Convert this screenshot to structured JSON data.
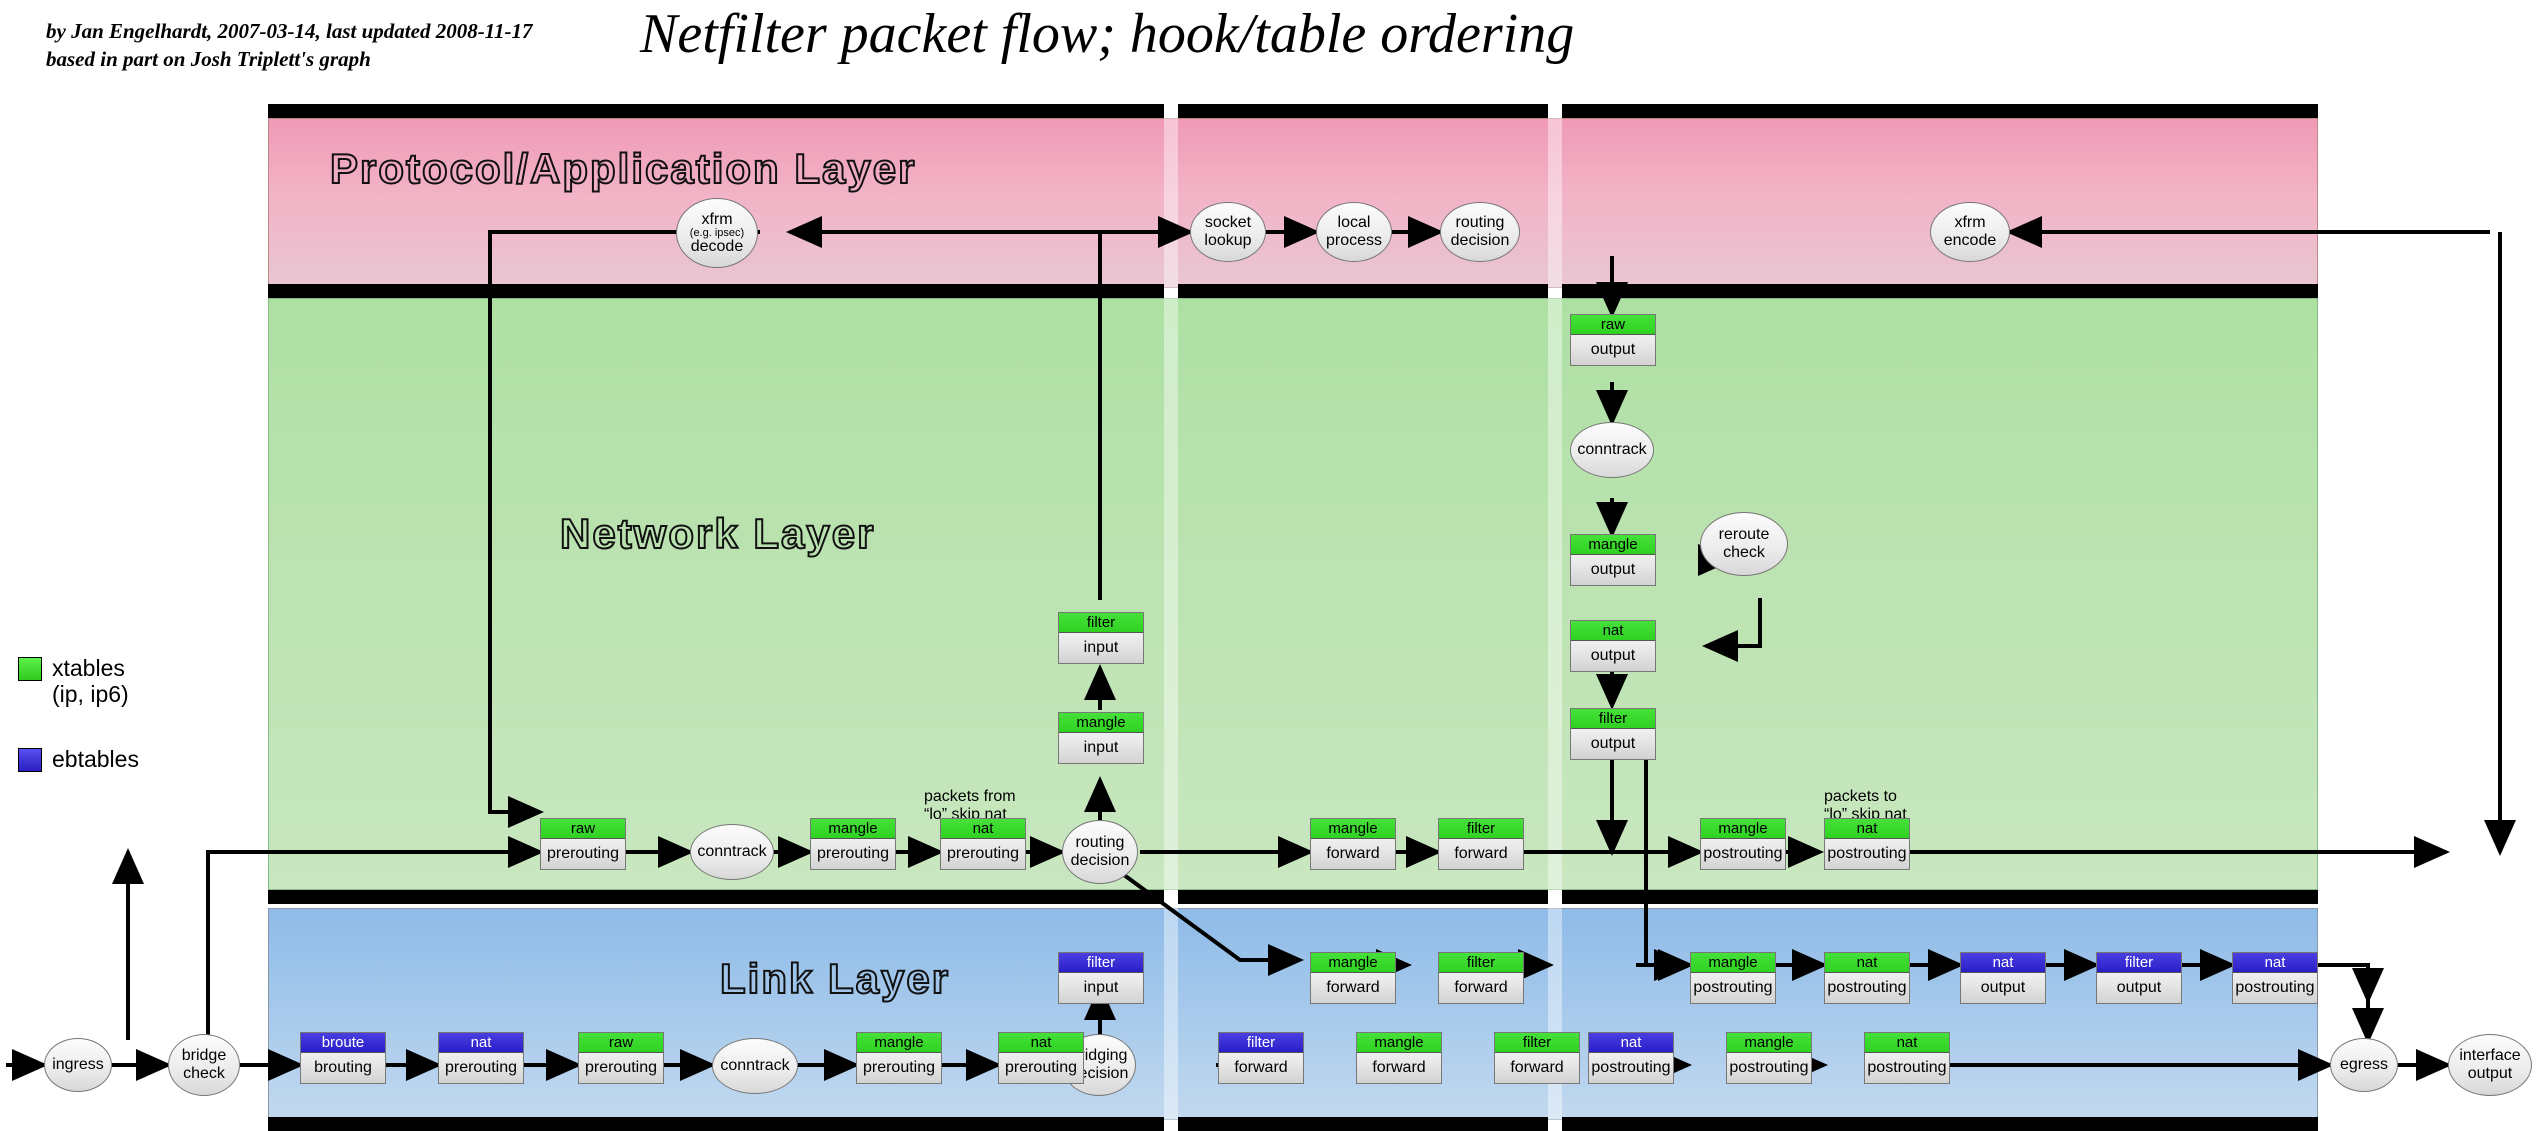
{
  "header": {
    "title": "Netfilter packet flow; hook/table ordering",
    "credit_line1": "by Jan Engelhardt, 2007-03-14, last updated 2008-11-17",
    "credit_line2": "based in part on Josh Triplett's graph"
  },
  "legend": {
    "items": [
      {
        "label": "xtables\n(ip, ip6)",
        "label_line1": "xtables",
        "label_line2": "(ip, ip6)",
        "color": "#3fd82f"
      },
      {
        "label": "ebtables",
        "label_line1": "ebtables",
        "label_line2": "",
        "color": "#3a2fd8"
      }
    ]
  },
  "layers": [
    {
      "name": "protocol",
      "title": "Protocol/Application Layer",
      "color": "#f0a0ba"
    },
    {
      "name": "network",
      "title": "Network Layer",
      "color": "#b4e2a8"
    },
    {
      "name": "link",
      "title": "Link Layer",
      "color": "#9cc4ea"
    }
  ],
  "nodes": {
    "ingress": "ingress",
    "bridge_check_l1": "bridge",
    "bridge_check_l2": "check",
    "conntrack": "conntrack",
    "bridging_decision_l1": "bridging",
    "bridging_decision_l2": "decision",
    "routing_decision_l1": "routing",
    "routing_decision_l2": "decision",
    "reroute_check_l1": "reroute",
    "reroute_check_l2": "check",
    "socket_lookup_l1": "socket",
    "socket_lookup_l2": "lookup",
    "local_process_l1": "local",
    "local_process_l2": "process",
    "xfrm_decode_l1": "xfrm",
    "xfrm_decode_sub": "(e.g. ipsec)",
    "xfrm_decode_l3": "decode",
    "xfrm_encode_l1": "xfrm",
    "xfrm_encode_l2": "encode",
    "egress": "egress",
    "interface_output_l1": "interface",
    "interface_output_l2": "output"
  },
  "notes": {
    "packets_from_lo_1": "packets from",
    "packets_from_lo_2": "“lo” skip nat",
    "packets_to_lo_1": "packets to",
    "packets_to_lo_2": "“lo” skip nat"
  },
  "chains": {
    "net_raw_pre": {
      "table": "raw",
      "chain": "prerouting",
      "family": "xtables"
    },
    "net_mangle_pre": {
      "table": "mangle",
      "chain": "prerouting",
      "family": "xtables"
    },
    "net_nat_pre": {
      "table": "nat",
      "chain": "prerouting",
      "family": "xtables"
    },
    "net_mangle_input": {
      "table": "mangle",
      "chain": "input",
      "family": "xtables"
    },
    "net_filter_input": {
      "table": "filter",
      "chain": "input",
      "family": "xtables"
    },
    "net_mangle_fwd": {
      "table": "mangle",
      "chain": "forward",
      "family": "xtables"
    },
    "net_filter_fwd": {
      "table": "filter",
      "chain": "forward",
      "family": "xtables"
    },
    "net_mangle_post": {
      "table": "mangle",
      "chain": "postrouting",
      "family": "xtables"
    },
    "net_nat_post": {
      "table": "nat",
      "chain": "postrouting",
      "family": "xtables"
    },
    "net_raw_out": {
      "table": "raw",
      "chain": "output",
      "family": "xtables"
    },
    "net_mangle_out": {
      "table": "mangle",
      "chain": "output",
      "family": "xtables"
    },
    "net_nat_out": {
      "table": "nat",
      "chain": "output",
      "family": "xtables"
    },
    "net_filter_out": {
      "table": "filter",
      "chain": "output",
      "family": "xtables"
    },
    "link_broute": {
      "table": "broute",
      "chain": "brouting",
      "family": "ebtables"
    },
    "link_nat_pre_eb": {
      "table": "nat",
      "chain": "prerouting",
      "family": "ebtables"
    },
    "link_raw_pre": {
      "table": "raw",
      "chain": "prerouting",
      "family": "xtables"
    },
    "link_mangle_pre": {
      "table": "mangle",
      "chain": "prerouting",
      "family": "xtables"
    },
    "link_nat_pre": {
      "table": "nat",
      "chain": "prerouting",
      "family": "xtables"
    },
    "link_filter_in_eb": {
      "table": "filter",
      "chain": "input",
      "family": "ebtables"
    },
    "link_filter_fwd_eb": {
      "table": "filter",
      "chain": "forward",
      "family": "ebtables"
    },
    "link_mangle_fwd": {
      "table": "mangle",
      "chain": "forward",
      "family": "xtables"
    },
    "link_filter_fwd": {
      "table": "filter",
      "chain": "forward",
      "family": "xtables"
    },
    "link_nat_post_eb": {
      "table": "nat",
      "chain": "postrouting",
      "family": "ebtables"
    },
    "link_mangle_post": {
      "table": "mangle",
      "chain": "postrouting",
      "family": "xtables"
    },
    "link_nat_post": {
      "table": "nat",
      "chain": "postrouting",
      "family": "xtables"
    },
    "link_mangle_fwd_up": {
      "table": "mangle",
      "chain": "forward",
      "family": "xtables"
    },
    "link_filter_fwd_up": {
      "table": "filter",
      "chain": "forward",
      "family": "xtables"
    },
    "link_mangle_post_up": {
      "table": "mangle",
      "chain": "postrouting",
      "family": "xtables"
    },
    "link_nat_post_up": {
      "table": "nat",
      "chain": "postrouting",
      "family": "xtables"
    },
    "link_nat_out_eb": {
      "table": "nat",
      "chain": "output",
      "family": "ebtables"
    },
    "link_filter_out_eb": {
      "table": "filter",
      "chain": "output",
      "family": "ebtables"
    },
    "link_nat_post_eb2": {
      "table": "nat",
      "chain": "postrouting",
      "family": "ebtables"
    },
    "link_filter_in_up": {
      "table": "filter",
      "chain": "input",
      "family": "ebtables"
    }
  }
}
